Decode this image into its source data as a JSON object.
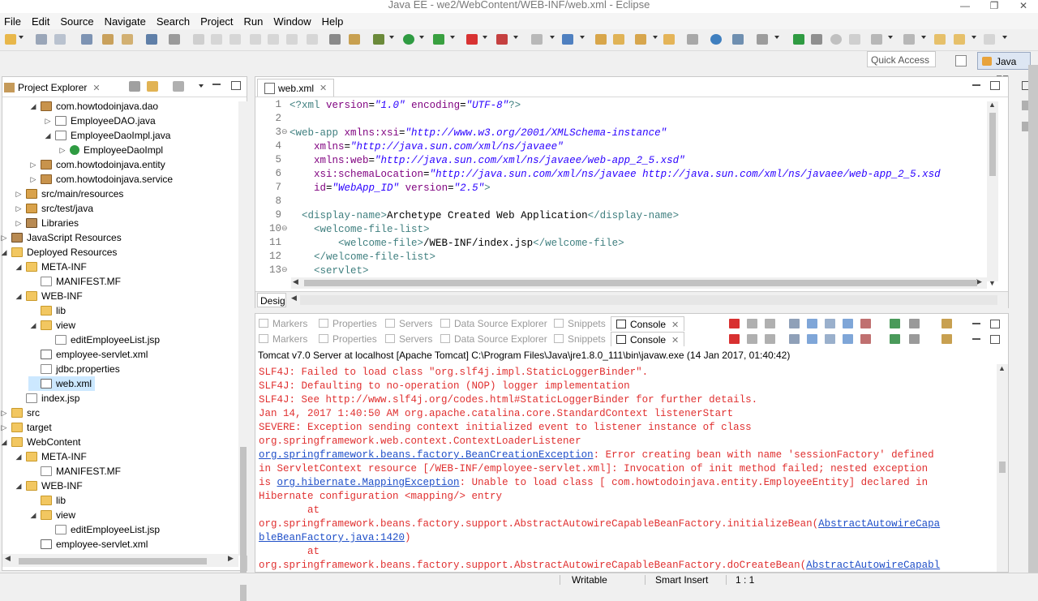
{
  "window": {
    "title": "Java EE - we2/WebContent/WEB-INF/web.xml - Eclipse",
    "controls": [
      "—",
      "❐",
      "✕"
    ]
  },
  "menu": [
    "File",
    "Edit",
    "Source",
    "Navigate",
    "Search",
    "Project",
    "Run",
    "Window",
    "Help"
  ],
  "toolbar": {
    "quick_access_placeholder": "Quick Access",
    "perspective_label": "Java EE"
  },
  "project_explorer": {
    "title": "Project Explorer",
    "close_glyph": "✕",
    "rows": [
      {
        "label": "com.howtodoinjava.dao",
        "twisty": "◢",
        "icon": "pkg",
        "indent": 4
      },
      {
        "label": "EmployeeDAO.java",
        "twisty": "▷",
        "icon": "java",
        "indent": 5
      },
      {
        "label": "EmployeeDaoImpl.java",
        "twisty": "◢",
        "icon": "java",
        "indent": 5
      },
      {
        "label": "EmployeeDaoImpl",
        "twisty": "▷",
        "icon": "class",
        "indent": 6
      },
      {
        "label": "com.howtodoinjava.entity",
        "twisty": "▷",
        "icon": "pkg",
        "indent": 4
      },
      {
        "label": "com.howtodoinjava.service",
        "twisty": "▷",
        "icon": "pkg",
        "indent": 4
      },
      {
        "label": "src/main/resources",
        "twisty": "▷",
        "icon": "srcf",
        "indent": 3
      },
      {
        "label": "src/test/java",
        "twisty": "▷",
        "icon": "srcf",
        "indent": 3
      },
      {
        "label": "Libraries",
        "twisty": "▷",
        "icon": "lib",
        "indent": 3
      },
      {
        "label": "JavaScript Resources",
        "twisty": "▷",
        "icon": "lib",
        "indent": 2
      },
      {
        "label": "Deployed Resources",
        "twisty": "◢",
        "icon": "folder",
        "indent": 2
      },
      {
        "label": "META-INF",
        "twisty": "◢",
        "icon": "folder",
        "indent": 3
      },
      {
        "label": "MANIFEST.MF",
        "twisty": "",
        "icon": "file",
        "indent": 4
      },
      {
        "label": "WEB-INF",
        "twisty": "◢",
        "icon": "folder",
        "indent": 3
      },
      {
        "label": "lib",
        "twisty": "",
        "icon": "folder",
        "indent": 4
      },
      {
        "label": "view",
        "twisty": "◢",
        "icon": "folder",
        "indent": 4
      },
      {
        "label": "editEmployeeList.jsp",
        "twisty": "",
        "icon": "file",
        "indent": 5
      },
      {
        "label": "employee-servlet.xml",
        "twisty": "",
        "icon": "xml",
        "indent": 4
      },
      {
        "label": "jdbc.properties",
        "twisty": "",
        "icon": "file",
        "indent": 4
      },
      {
        "label": "web.xml",
        "twisty": "",
        "icon": "xml",
        "indent": 4,
        "selected": true
      },
      {
        "label": "index.jsp",
        "twisty": "",
        "icon": "file",
        "indent": 3
      },
      {
        "label": "src",
        "twisty": "▷",
        "icon": "folder",
        "indent": 2
      },
      {
        "label": "target",
        "twisty": "▷",
        "icon": "folder",
        "indent": 2
      },
      {
        "label": "WebContent",
        "twisty": "◢",
        "icon": "folder",
        "indent": 2
      },
      {
        "label": "META-INF",
        "twisty": "◢",
        "icon": "folder",
        "indent": 3
      },
      {
        "label": "MANIFEST.MF",
        "twisty": "",
        "icon": "file",
        "indent": 4
      },
      {
        "label": "WEB-INF",
        "twisty": "◢",
        "icon": "folder",
        "indent": 3
      },
      {
        "label": "lib",
        "twisty": "",
        "icon": "folder",
        "indent": 4
      },
      {
        "label": "view",
        "twisty": "◢",
        "icon": "folder",
        "indent": 4
      },
      {
        "label": "editEmployeeList.jsp",
        "twisty": "",
        "icon": "file",
        "indent": 5
      },
      {
        "label": "employee-servlet.xml",
        "twisty": "",
        "icon": "xml",
        "indent": 4
      }
    ]
  },
  "editor": {
    "tab_label": "web.xml",
    "close_glyph": "✕",
    "design_tab": "Design",
    "lines": [
      {
        "n": "1",
        "fold": "",
        "segs": [
          [
            "tag",
            "<?xml "
          ],
          [
            "attr",
            "version"
          ],
          [
            "txt",
            "="
          ],
          [
            "val",
            "\"1.0\""
          ],
          [
            "txt",
            " "
          ],
          [
            "attr",
            "encoding"
          ],
          [
            "txt",
            "="
          ],
          [
            "val",
            "\"UTF-8\""
          ],
          [
            "tag",
            "?>"
          ]
        ]
      },
      {
        "n": "2",
        "fold": "",
        "segs": []
      },
      {
        "n": "3",
        "fold": "⊖",
        "segs": [
          [
            "tag",
            "<web-app "
          ],
          [
            "attr",
            "xmlns:xsi"
          ],
          [
            "txt",
            "="
          ],
          [
            "val",
            "\"http://www.w3.org/2001/XMLSchema-instance\""
          ]
        ]
      },
      {
        "n": "4",
        "fold": "",
        "segs": [
          [
            "txt",
            "    "
          ],
          [
            "attr",
            "xmlns"
          ],
          [
            "txt",
            "="
          ],
          [
            "val",
            "\"http://java.sun.com/xml/ns/javaee\""
          ]
        ]
      },
      {
        "n": "5",
        "fold": "",
        "segs": [
          [
            "txt",
            "    "
          ],
          [
            "attr",
            "xmlns:web"
          ],
          [
            "txt",
            "="
          ],
          [
            "val",
            "\"http://java.sun.com/xml/ns/javaee/web-app_2_5.xsd\""
          ]
        ]
      },
      {
        "n": "6",
        "fold": "",
        "segs": [
          [
            "txt",
            "    "
          ],
          [
            "attr",
            "xsi:schemaLocation"
          ],
          [
            "txt",
            "="
          ],
          [
            "val",
            "\"http://java.sun.com/xml/ns/javaee http://java.sun.com/xml/ns/javaee/web-app_2_5.xsd"
          ]
        ]
      },
      {
        "n": "7",
        "fold": "",
        "segs": [
          [
            "txt",
            "    "
          ],
          [
            "attr",
            "id"
          ],
          [
            "txt",
            "="
          ],
          [
            "val",
            "\"WebApp_ID\""
          ],
          [
            "txt",
            " "
          ],
          [
            "attr",
            "version"
          ],
          [
            "txt",
            "="
          ],
          [
            "val",
            "\"2.5\""
          ],
          [
            "tag",
            ">"
          ]
        ]
      },
      {
        "n": "8",
        "fold": "",
        "segs": []
      },
      {
        "n": "9",
        "fold": "",
        "segs": [
          [
            "txt",
            "  "
          ],
          [
            "tag",
            "<display-name>"
          ],
          [
            "txt",
            "Archetype Created Web Application"
          ],
          [
            "tag",
            "</display-name>"
          ]
        ]
      },
      {
        "n": "10",
        "fold": "⊖",
        "segs": [
          [
            "txt",
            "    "
          ],
          [
            "tag",
            "<welcome-file-list>"
          ]
        ]
      },
      {
        "n": "11",
        "fold": "",
        "segs": [
          [
            "txt",
            "        "
          ],
          [
            "tag",
            "<welcome-file>"
          ],
          [
            "txt",
            "/WEB-INF/index.jsp"
          ],
          [
            "tag",
            "</welcome-file>"
          ]
        ]
      },
      {
        "n": "12",
        "fold": "",
        "segs": [
          [
            "txt",
            "    "
          ],
          [
            "tag",
            "</welcome-file-list>"
          ]
        ]
      },
      {
        "n": "13",
        "fold": "⊖",
        "segs": [
          [
            "txt",
            "    "
          ],
          [
            "tag",
            "<servlet>"
          ]
        ]
      }
    ]
  },
  "console": {
    "tabs": [
      "Markers",
      "Properties",
      "Servers",
      "Data Source Explorer",
      "Snippets",
      "Console"
    ],
    "close_glyph": "✕",
    "description": "Tomcat v7.0 Server at localhost [Apache Tomcat] C:\\Program Files\\Java\\jre1.8.0_111\\bin\\javaw.exe (14 Jan 2017, 01:40:42)",
    "lines": [
      [
        [
          "t",
          "SLF4J: Failed to load class \"org.slf4j.impl.StaticLoggerBinder\"."
        ]
      ],
      [
        [
          "t",
          "SLF4J: Defaulting to no-operation (NOP) logger implementation"
        ]
      ],
      [
        [
          "t",
          "SLF4J: See http://www.slf4j.org/codes.html#StaticLoggerBinder for further details."
        ]
      ],
      [
        [
          "t",
          "Jan 14, 2017 1:40:50 AM org.apache.catalina.core.StandardContext listenerStart"
        ]
      ],
      [
        [
          "t",
          "SEVERE: Exception sending context initialized event to listener instance of class"
        ]
      ],
      [
        [
          "t",
          "org.springframework.web.context.ContextLoaderListener"
        ]
      ],
      [
        [
          "l",
          "org.springframework.beans.factory.BeanCreationException"
        ],
        [
          "t",
          ": Error creating bean with name 'sessionFactory' defined"
        ]
      ],
      [
        [
          "t",
          "in ServletContext resource [/WEB-INF/employee-servlet.xml]: Invocation of init method failed; nested exception"
        ]
      ],
      [
        [
          "t",
          "is "
        ],
        [
          "l",
          "org.hibernate.MappingException"
        ],
        [
          "t",
          ": Unable to load class [ com.howtodoinjava.entity.EmployeeEntity] declared in"
        ]
      ],
      [
        [
          "t",
          "Hibernate configuration <mapping/> entry"
        ]
      ],
      [
        [
          "t",
          "        at"
        ]
      ],
      [
        [
          "t",
          "org.springframework.beans.factory.support.AbstractAutowireCapableBeanFactory.initializeBean("
        ],
        [
          "l",
          "AbstractAutowireCapa"
        ]
      ],
      [
        [
          "l",
          "bleBeanFactory.java:1420"
        ],
        [
          "t",
          ")"
        ]
      ],
      [
        [
          "t",
          "        at"
        ]
      ],
      [
        [
          "t",
          "org.springframework.beans.factory.support.AbstractAutowireCapableBeanFactory.doCreateBean("
        ],
        [
          "l",
          "AbstractAutowireCapabl"
        ]
      ]
    ]
  },
  "status": {
    "writable": "Writable",
    "insert_mode": "Smart Insert",
    "position": "1 : 1"
  },
  "colors": {
    "xml_tag": "#3f7f7f",
    "xml_attr": "#7f007f",
    "xml_value": "#2a00ff",
    "console_error": "#e03030",
    "console_link": "#1f4fc8",
    "selection": "#cce8ff"
  }
}
